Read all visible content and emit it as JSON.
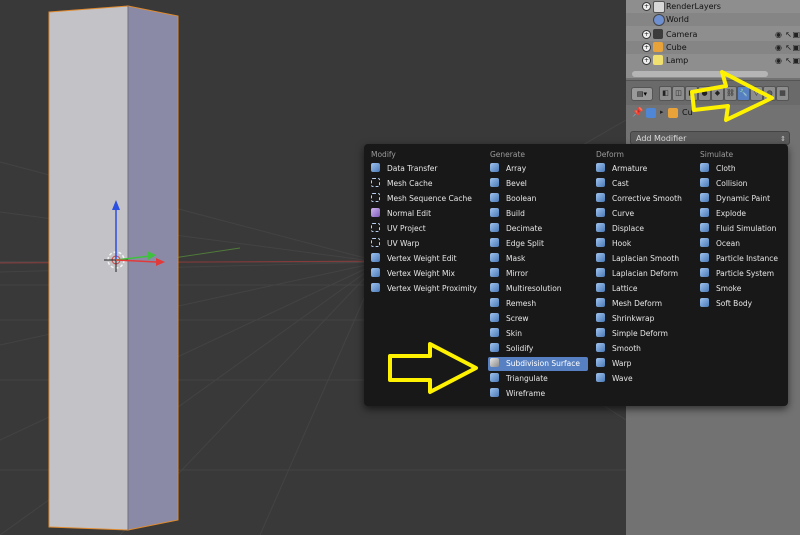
{
  "outliner": {
    "rows": [
      {
        "label": "RenderLayers",
        "icon": "render-layers-icon"
      },
      {
        "label": "World",
        "icon": "world-icon"
      },
      {
        "label": "Camera",
        "icon": "camera-icon"
      },
      {
        "label": "Cube",
        "icon": "cube-icon"
      },
      {
        "label": "Lamp",
        "icon": "lamp-icon"
      }
    ]
  },
  "properties": {
    "context_tabs": [
      "render-tab",
      "render-layers-tab",
      "scene-tab",
      "world-tab",
      "object-tab",
      "constraints-tab",
      "modifiers-tab",
      "data-tab",
      "material-tab",
      "texture-tab"
    ],
    "active_tab": "modifiers-tab",
    "breadcrumb": "Cu",
    "add_modifier_label": "Add Modifier"
  },
  "modifier_menu": {
    "columns": [
      {
        "header": "Modify",
        "items": [
          {
            "label": "Data Transfer",
            "icon": "ico-blue"
          },
          {
            "label": "Mesh Cache",
            "icon": "ico-frame"
          },
          {
            "label": "Mesh Sequence Cache",
            "icon": "ico-frame"
          },
          {
            "label": "Normal Edit",
            "icon": "ico-purple"
          },
          {
            "label": "UV Project",
            "icon": "ico-frame"
          },
          {
            "label": "UV Warp",
            "icon": "ico-frame"
          },
          {
            "label": "Vertex Weight Edit",
            "icon": "ico-blue"
          },
          {
            "label": "Vertex Weight Mix",
            "icon": "ico-blue"
          },
          {
            "label": "Vertex Weight Proximity",
            "icon": "ico-blue"
          }
        ]
      },
      {
        "header": "Generate",
        "items": [
          {
            "label": "Array",
            "icon": "ico-blue"
          },
          {
            "label": "Bevel",
            "icon": "ico-blue"
          },
          {
            "label": "Boolean",
            "icon": "ico-blue"
          },
          {
            "label": "Build",
            "icon": "ico-blue"
          },
          {
            "label": "Decimate",
            "icon": "ico-blue"
          },
          {
            "label": "Edge Split",
            "icon": "ico-blue"
          },
          {
            "label": "Mask",
            "icon": "ico-blue"
          },
          {
            "label": "Mirror",
            "icon": "ico-blue"
          },
          {
            "label": "Multiresolution",
            "icon": "ico-blue"
          },
          {
            "label": "Remesh",
            "icon": "ico-blue"
          },
          {
            "label": "Screw",
            "icon": "ico-blue"
          },
          {
            "label": "Skin",
            "icon": "ico-blue"
          },
          {
            "label": "Solidify",
            "icon": "ico-blue"
          },
          {
            "label": "Subdivision Surface",
            "icon": "ico-grey"
          },
          {
            "label": "Triangulate",
            "icon": "ico-blue"
          },
          {
            "label": "Wireframe",
            "icon": "ico-blue"
          }
        ]
      },
      {
        "header": "Deform",
        "items": [
          {
            "label": "Armature",
            "icon": "ico-blue"
          },
          {
            "label": "Cast",
            "icon": "ico-blue"
          },
          {
            "label": "Corrective Smooth",
            "icon": "ico-blue"
          },
          {
            "label": "Curve",
            "icon": "ico-blue"
          },
          {
            "label": "Displace",
            "icon": "ico-blue"
          },
          {
            "label": "Hook",
            "icon": "ico-blue"
          },
          {
            "label": "Laplacian Smooth",
            "icon": "ico-blue"
          },
          {
            "label": "Laplacian Deform",
            "icon": "ico-blue"
          },
          {
            "label": "Lattice",
            "icon": "ico-blue"
          },
          {
            "label": "Mesh Deform",
            "icon": "ico-blue"
          },
          {
            "label": "Shrinkwrap",
            "icon": "ico-blue"
          },
          {
            "label": "Simple Deform",
            "icon": "ico-blue"
          },
          {
            "label": "Smooth",
            "icon": "ico-blue"
          },
          {
            "label": "Warp",
            "icon": "ico-blue"
          },
          {
            "label": "Wave",
            "icon": "ico-blue"
          }
        ]
      },
      {
        "header": "Simulate",
        "items": [
          {
            "label": "Cloth",
            "icon": "ico-blue"
          },
          {
            "label": "Collision",
            "icon": "ico-blue"
          },
          {
            "label": "Dynamic Paint",
            "icon": "ico-blue"
          },
          {
            "label": "Explode",
            "icon": "ico-blue"
          },
          {
            "label": "Fluid Simulation",
            "icon": "ico-blue"
          },
          {
            "label": "Ocean",
            "icon": "ico-blue"
          },
          {
            "label": "Particle Instance",
            "icon": "ico-blue"
          },
          {
            "label": "Particle System",
            "icon": "ico-blue"
          },
          {
            "label": "Smoke",
            "icon": "ico-blue"
          },
          {
            "label": "Soft Body",
            "icon": "ico-blue"
          }
        ]
      }
    ],
    "highlighted": "Subdivision Surface"
  },
  "colors": {
    "highlight": "#5680c2",
    "annotation_arrow": "#fff200",
    "menu_bg": "#181818",
    "selection_outline": "#e08a2e"
  }
}
